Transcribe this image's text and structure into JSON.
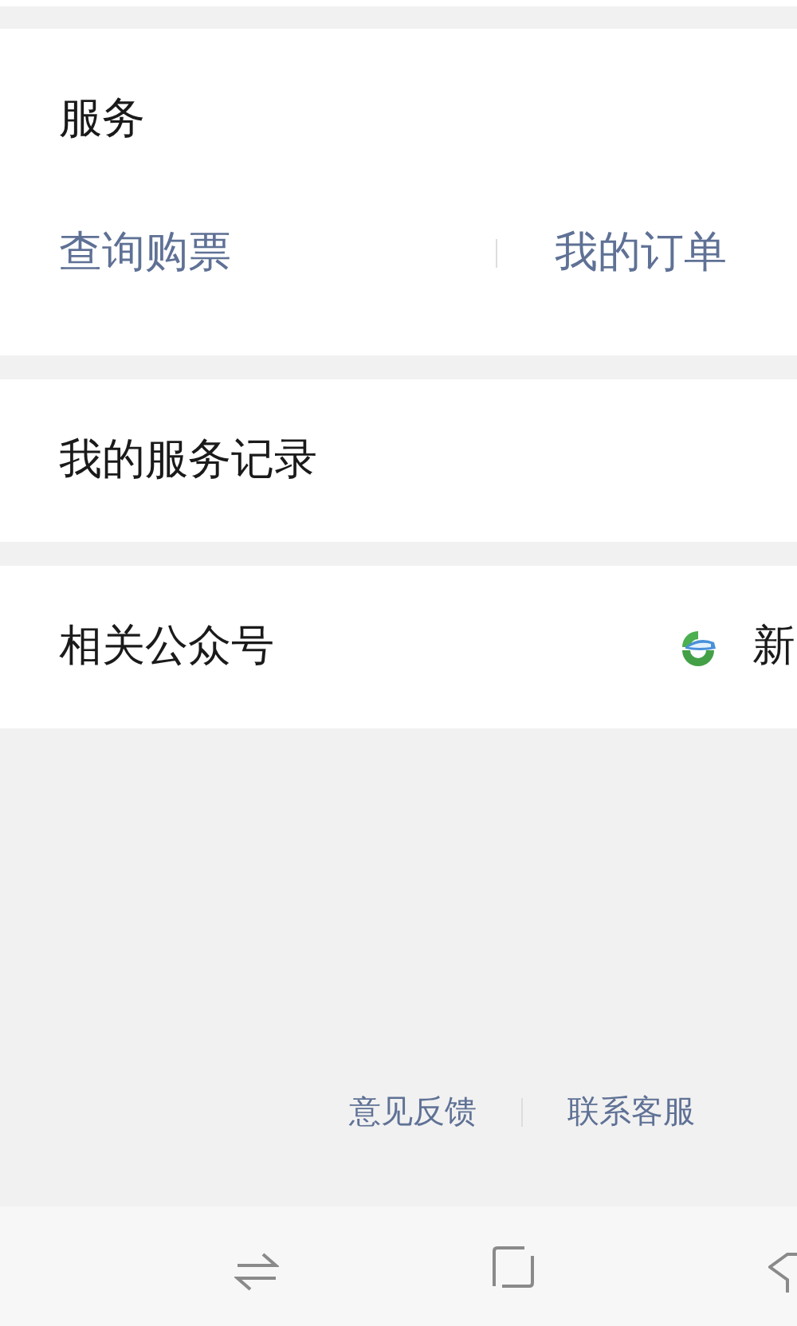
{
  "service": {
    "title": "服务",
    "links": [
      {
        "label": "查询购票"
      },
      {
        "label": "我的订单"
      }
    ]
  },
  "records": {
    "title": "我的服务记录"
  },
  "accounts": {
    "title": "相关公众号",
    "account_name": "新"
  },
  "footer_links": [
    {
      "label": "意见反馈"
    },
    {
      "label": "联系客服"
    }
  ],
  "nav_bar": [
    {
      "kind": "switch"
    },
    {
      "kind": "home"
    },
    {
      "kind": "back"
    }
  ]
}
